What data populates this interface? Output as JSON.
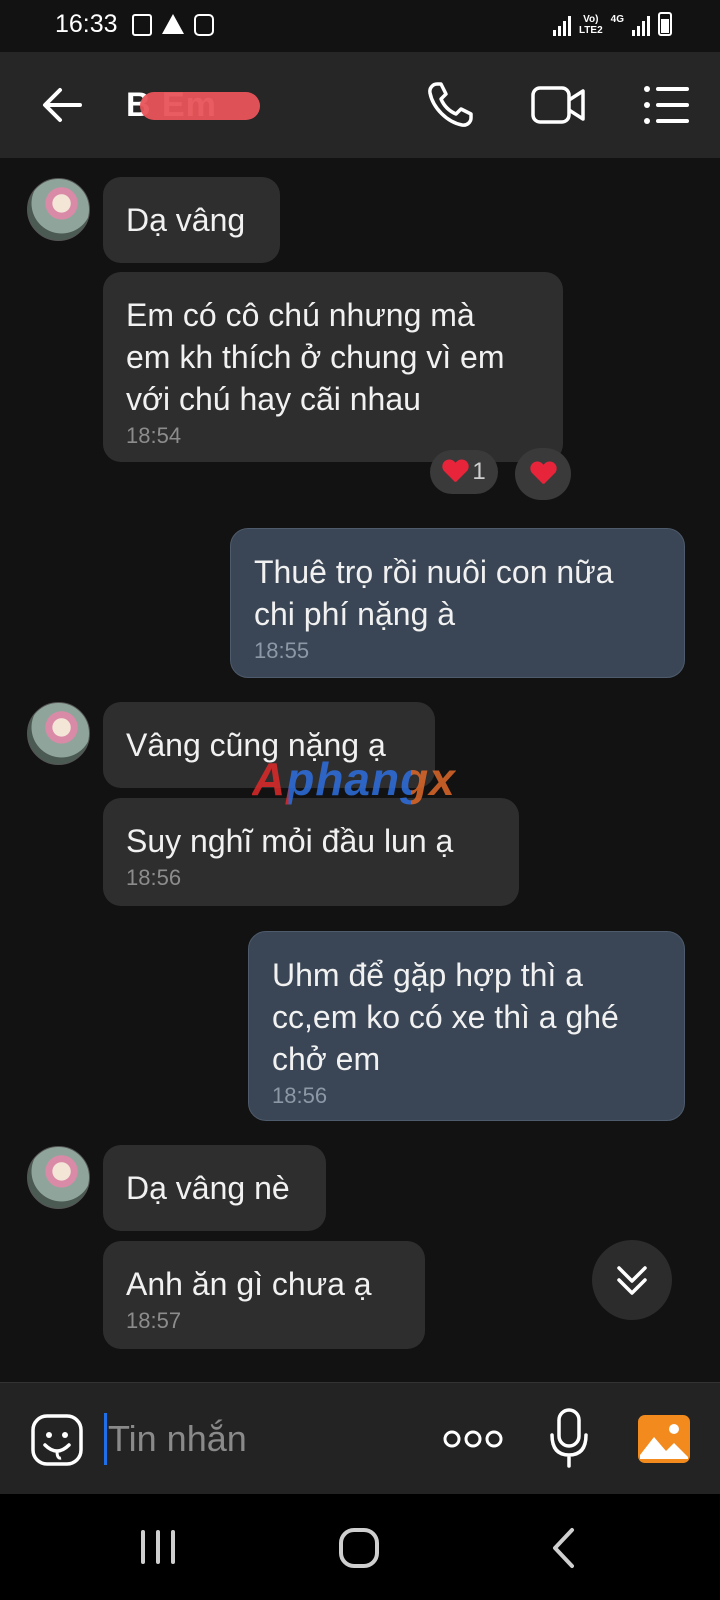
{
  "status_bar": {
    "time": "16:33",
    "network_label_top": "Vo)",
    "network_label_bottom": "LTE2",
    "network_type": "4G"
  },
  "header": {
    "contact_name": "B     Em",
    "icons": [
      "back-arrow-icon",
      "phone-call-icon",
      "video-call-icon",
      "menu-icon"
    ]
  },
  "messages": [
    {
      "direction": "in",
      "text": "Dạ vâng",
      "time": ""
    },
    {
      "direction": "in",
      "text": "Em có cô chú nhưng mà\nem kh thích ở chung vì em\nvới chú hay cãi nhau",
      "time": "18:54"
    },
    {
      "direction": "out",
      "text": "Thuê trọ rồi nuôi con nữa\nchi phí nặng à",
      "time": "18:55"
    },
    {
      "direction": "in",
      "text": "Vâng cũng nặng ạ",
      "time": ""
    },
    {
      "direction": "in",
      "text": "Suy nghĩ mỏi đầu lun ạ",
      "time": "18:56"
    },
    {
      "direction": "out",
      "text": "Uhm để gặp hợp thì a\ncc,em ko có xe thì a ghé\nchở em",
      "time": "18:56"
    },
    {
      "direction": "in",
      "text": "Dạ vâng nè",
      "time": ""
    },
    {
      "direction": "in",
      "text": "Anh ăn gì chưa ạ",
      "time": "18:57"
    }
  ],
  "reactions": {
    "count": "1",
    "icon": "heart-icon"
  },
  "watermark": "Aphangx",
  "input": {
    "placeholder": "Tin nhắn"
  },
  "colors": {
    "background": "#121212",
    "incoming_bubble": "#2e2e2e",
    "outgoing_bubble": "#3a4655",
    "accent_cursor": "#1e6fe8",
    "image_button": "#f28a1e",
    "heart": "#e8243b"
  }
}
